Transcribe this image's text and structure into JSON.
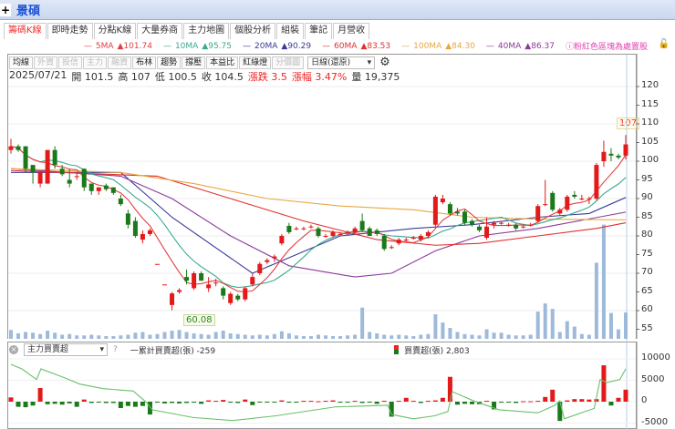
{
  "window": {
    "title": "景碩"
  },
  "tabs": [
    "籌碼K線",
    "即時走勢",
    "分點K線",
    "大量券商",
    "主力地圖",
    "個股分析",
    "組裝",
    "筆記",
    "月營收"
  ],
  "ma_legend": [
    {
      "label": "5MA",
      "value": "▲101.74",
      "color": "#e04040"
    },
    {
      "label": "10MA",
      "value": "▲95.75",
      "color": "#3aaa90"
    },
    {
      "label": "20MA",
      "value": "▲90.29",
      "color": "#3a3a9a"
    },
    {
      "label": "60MA",
      "value": "▲83.53",
      "color": "#e03030"
    },
    {
      "label": "100MA",
      "value": "▲84.30",
      "color": "#e8a840"
    },
    {
      "label": "40MA",
      "value": "▲86.37",
      "color": "#8a3a9a"
    }
  ],
  "note": "ⓘ粉紅色區塊為處置股",
  "toolbar": {
    "buttons": [
      {
        "label": "均線",
        "enabled": true
      },
      {
        "label": "外資",
        "enabled": false
      },
      {
        "label": "投信",
        "enabled": false
      },
      {
        "label": "主力",
        "enabled": false
      },
      {
        "label": "融資",
        "enabled": false
      },
      {
        "label": "布林",
        "enabled": true
      },
      {
        "label": "趨勢",
        "enabled": true
      },
      {
        "label": "撐壓",
        "enabled": true
      },
      {
        "label": "本益比",
        "enabled": true
      },
      {
        "label": "紅綠燈",
        "enabled": true
      },
      {
        "label": "分價圖",
        "enabled": false
      }
    ],
    "period": "日線(還原)"
  },
  "info": {
    "date": "2025/07/21",
    "open": "開 101.5",
    "high": "高 107",
    "low": "低 100.5",
    "close": "收 104.5",
    "change": "漲跌 3.5",
    "pct": "漲幅 3.47%",
    "volume": "量 19,375"
  },
  "price_label": "107",
  "low_label": "60.08",
  "lower": {
    "indicator": "主力買賣超",
    "help": "?",
    "cum_label": "一累計買賣超(張) -259",
    "bar_label": "買賣超(張) 2,803"
  },
  "chart_data": {
    "type": "candlestick",
    "y_ticks": [
      120,
      115,
      110,
      105,
      100,
      95,
      90,
      85,
      80,
      75,
      70,
      65,
      60,
      55
    ],
    "ylim": [
      53,
      122
    ],
    "candles_ohlc": [
      [
        103,
        106,
        102,
        104
      ],
      [
        104,
        104.5,
        102.5,
        103
      ],
      [
        104,
        104,
        97,
        98
      ],
      [
        99,
        99,
        94,
        97
      ],
      [
        94,
        97,
        93,
        97
      ],
      [
        94,
        103,
        94,
        103
      ],
      [
        103,
        104,
        98,
        99
      ],
      [
        98,
        99,
        96,
        96.5
      ],
      [
        95,
        98,
        93,
        94
      ],
      [
        96,
        97,
        95,
        96
      ],
      [
        98,
        98,
        92,
        93
      ],
      [
        94,
        94,
        91,
        92
      ],
      [
        92,
        93,
        91,
        93
      ],
      [
        93.5,
        94,
        92,
        92.5
      ],
      [
        93,
        93,
        91,
        91.5
      ],
      [
        90,
        91,
        88,
        88.5
      ],
      [
        86,
        87,
        82,
        83
      ],
      [
        84,
        85,
        79.5,
        80
      ],
      [
        79,
        81.5,
        78,
        80.5
      ],
      [
        80.5,
        82,
        80,
        81.5
      ],
      [
        72.5,
        72.5,
        72.5,
        72.5
      ],
      [
        67,
        67,
        67,
        67
      ],
      [
        61.5,
        65,
        60.08,
        64.6
      ],
      [
        65,
        66,
        64.5,
        65.5
      ],
      [
        69,
        71,
        67,
        68
      ],
      [
        66,
        70.5,
        65.5,
        70
      ],
      [
        70,
        70.5,
        68,
        68
      ],
      [
        66,
        69,
        65,
        67
      ],
      [
        67.5,
        68.5,
        66.5,
        67.5
      ],
      [
        66,
        66.5,
        63,
        64
      ],
      [
        62,
        65,
        61.5,
        64.5
      ],
      [
        64,
        64.5,
        62.5,
        63
      ],
      [
        63,
        66.5,
        62.5,
        66
      ],
      [
        67,
        70,
        66.5,
        69
      ],
      [
        70,
        73,
        69.5,
        72.5
      ],
      [
        73,
        74,
        72.5,
        73.5
      ],
      [
        74,
        75,
        73,
        74.5
      ],
      [
        78,
        80.5,
        77.5,
        80
      ],
      [
        82.7,
        83.5,
        80.5,
        81
      ],
      [
        82,
        82.5,
        81.5,
        82
      ],
      [
        82,
        82.5,
        81.5,
        82
      ],
      [
        82.5,
        83,
        82,
        82.5
      ],
      [
        82,
        82.5,
        79.5,
        80
      ],
      [
        80,
        80.5,
        79.5,
        80
      ],
      [
        80,
        81.5,
        79.5,
        81
      ],
      [
        80.5,
        81,
        80,
        80.5
      ],
      [
        81,
        81.5,
        80.5,
        81
      ],
      [
        81,
        82.5,
        80.5,
        82
      ],
      [
        84,
        86,
        81,
        81.5
      ],
      [
        82,
        82.5,
        80,
        80
      ],
      [
        81.5,
        82,
        80,
        80.5
      ],
      [
        80,
        80.5,
        76,
        76.5
      ],
      [
        77,
        77.5,
        76.5,
        77
      ],
      [
        78,
        79.5,
        77.5,
        79
      ],
      [
        79,
        79.5,
        78.5,
        79
      ],
      [
        79.5,
        80,
        79,
        79.5
      ],
      [
        79,
        80.5,
        78.5,
        80
      ],
      [
        80,
        81.5,
        79.5,
        81
      ],
      [
        83,
        91,
        82.5,
        90.5
      ],
      [
        89,
        91,
        88.5,
        90
      ],
      [
        88.5,
        89,
        85.5,
        86
      ],
      [
        86.5,
        87.5,
        85.5,
        86
      ],
      [
        86.5,
        87,
        83,
        83.5
      ],
      [
        84,
        84.5,
        82.5,
        83
      ],
      [
        82.5,
        83,
        81,
        81.5
      ],
      [
        79.5,
        85,
        79,
        82.5
      ],
      [
        83,
        84,
        82,
        83.5
      ],
      [
        83.5,
        84,
        83,
        83.5
      ],
      [
        83,
        83.5,
        82.5,
        83
      ],
      [
        83,
        83.5,
        81.5,
        82
      ],
      [
        82.5,
        83,
        82,
        82.5
      ],
      [
        83,
        83.5,
        82.5,
        83
      ],
      [
        84,
        88.5,
        83.5,
        88
      ],
      [
        88.5,
        95,
        88,
        88.5
      ],
      [
        91.5,
        92,
        86.5,
        87
      ],
      [
        86,
        87.5,
        85.5,
        87
      ],
      [
        87,
        91,
        86.5,
        90.5
      ],
      [
        91,
        92,
        90,
        90.5
      ],
      [
        90,
        91,
        89.5,
        90
      ],
      [
        90,
        90.5,
        88.5,
        90
      ],
      [
        90,
        99.5,
        89.5,
        99
      ],
      [
        100,
        105.5,
        98.5,
        102.5
      ],
      [
        102,
        103.5,
        100,
        101.5
      ],
      [
        101.5,
        102,
        100.5,
        101
      ],
      [
        101.5,
        107,
        100.5,
        104.5
      ]
    ],
    "volume": [
      6500,
      4000,
      5000,
      4500,
      3500,
      6000,
      4500,
      3000,
      3500,
      2500,
      2500,
      3000,
      2500,
      2000,
      2000,
      2500,
      3000,
      4500,
      5000,
      3000,
      3500,
      5000,
      6000,
      6500,
      5000,
      4000,
      3500,
      3000,
      5000,
      6000,
      4000,
      3500,
      3000,
      2500,
      3000,
      2500,
      3500,
      5500,
      4000,
      2500,
      2000,
      2000,
      3000,
      2500,
      2000,
      2000,
      2500,
      3000,
      23000,
      5000,
      4000,
      3000,
      2500,
      3000,
      2500,
      2000,
      3000,
      3500,
      18000,
      12000,
      8000,
      5000,
      3500,
      3000,
      2500,
      7000,
      4500,
      4500,
      3000,
      2500,
      2500,
      3000,
      20000,
      26000,
      22000,
      5000,
      13000,
      9000,
      3500,
      3000,
      56000,
      84000,
      19000,
      7000,
      19375
    ],
    "ma_knots": {
      "20MA": [
        [
          0,
          97
        ],
        [
          15,
          97
        ],
        [
          22,
          85
        ],
        [
          33,
          70
        ],
        [
          45,
          80
        ],
        [
          55,
          82
        ],
        [
          63,
          83
        ],
        [
          72,
          85
        ],
        [
          79,
          86
        ],
        [
          84,
          90.29
        ]
      ],
      "40MA": [
        [
          0,
          98
        ],
        [
          15,
          96
        ],
        [
          22,
          90
        ],
        [
          30,
          80
        ],
        [
          38,
          72
        ],
        [
          47,
          69
        ],
        [
          52,
          70
        ],
        [
          58,
          76
        ],
        [
          64,
          80
        ],
        [
          72,
          82
        ],
        [
          84,
          86.37
        ]
      ],
      "60MA": [
        [
          0,
          97.5
        ],
        [
          20,
          96
        ],
        [
          30,
          90
        ],
        [
          40,
          84
        ],
        [
          50,
          79
        ],
        [
          58,
          77.5
        ],
        [
          64,
          78
        ],
        [
          72,
          80
        ],
        [
          80,
          82
        ],
        [
          84,
          83.53
        ]
      ],
      "100MA": [
        [
          0,
          98
        ],
        [
          15,
          97
        ],
        [
          25,
          94
        ],
        [
          35,
          90
        ],
        [
          45,
          88
        ],
        [
          55,
          87
        ],
        [
          63,
          85
        ],
        [
          72,
          84.5
        ],
        [
          84,
          84.3
        ]
      ]
    },
    "lower": {
      "y_ticks": [
        10000,
        5000,
        0,
        -5000
      ],
      "bars": [
        1000,
        -1200,
        -1300,
        -900,
        3200,
        -600,
        -500,
        -700,
        -400,
        -1200,
        500,
        -300,
        -200,
        -300,
        -300,
        -1500,
        -1000,
        -1200,
        -1000,
        -3000,
        -100,
        -400,
        -300,
        -400,
        -300,
        -200,
        -500,
        300,
        200,
        400,
        -100,
        -300,
        500,
        -800,
        -200,
        -100,
        -100,
        300,
        -200,
        -200,
        200,
        200,
        100,
        200,
        300,
        -100,
        -100,
        200,
        -300,
        -200,
        -500,
        200,
        -3500,
        200,
        900,
        200,
        -300,
        200,
        300,
        900,
        5800,
        -700,
        -500,
        -600,
        -600,
        200,
        -1800,
        -200,
        -200,
        -300,
        100,
        100,
        200,
        1100,
        2800,
        -4500,
        300,
        600,
        600,
        500,
        600,
        8500,
        -900,
        900,
        2803
      ],
      "cumulative_knots": [
        [
          0,
          8700
        ],
        [
          1.5,
          7660
        ],
        [
          3.5,
          5180
        ],
        [
          4.1,
          7660
        ],
        [
          7.4,
          5530
        ],
        [
          9.4,
          4110
        ],
        [
          12.6,
          3050
        ],
        [
          16.7,
          2480
        ],
        [
          18.5,
          -140
        ],
        [
          19.3,
          -1900
        ],
        [
          24.9,
          -3700
        ],
        [
          30.3,
          -4400
        ],
        [
          36.2,
          -3300
        ],
        [
          44.4,
          -1200
        ],
        [
          51.5,
          -850
        ],
        [
          52,
          -3000
        ],
        [
          55,
          -4000
        ],
        [
          57.9,
          -3300
        ],
        [
          59.7,
          -2300
        ],
        [
          60.3,
          2340
        ],
        [
          63.2,
          200
        ],
        [
          66.7,
          -1900
        ],
        [
          72,
          -2600
        ],
        [
          74.3,
          -850
        ],
        [
          75,
          200
        ],
        [
          75.6,
          -4000
        ],
        [
          79.7,
          -1560
        ],
        [
          80.5,
          5180
        ],
        [
          81.4,
          4470
        ],
        [
          83.2,
          5180
        ],
        [
          84,
          7660
        ]
      ]
    }
  }
}
